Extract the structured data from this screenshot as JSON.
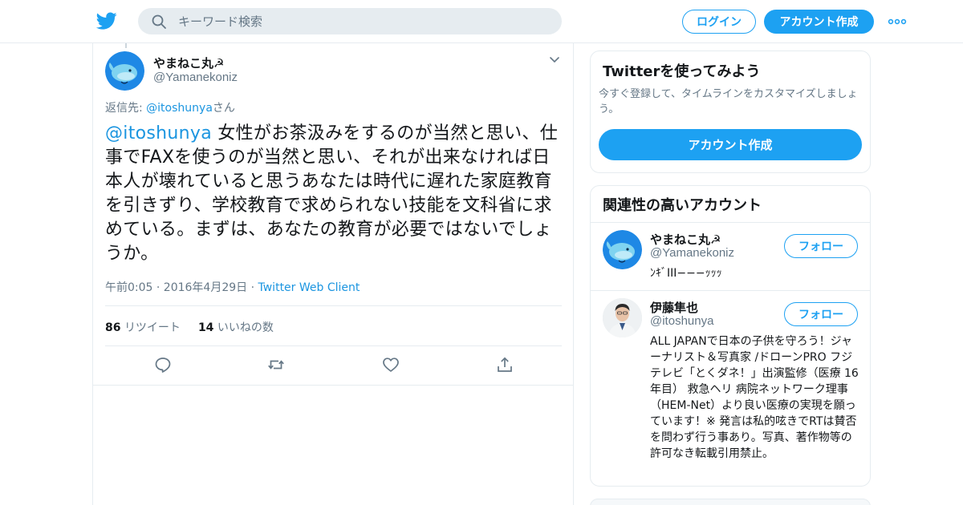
{
  "header": {
    "search_placeholder": "キーワード検索",
    "login_label": "ログイン",
    "signup_label": "アカウント作成"
  },
  "tweet": {
    "author_name": "やまねこ丸☭",
    "author_handle": "@Yamanekoniz",
    "reply_prefix": "返信先: ",
    "reply_mention": "@itoshunya",
    "reply_suffix": "さん",
    "mention": "@itoshunya",
    "body": " 女性がお茶汲みをするのが当然と思い、仕事でFAXを使うのが当然と思い、それが出来なければ日本人が壊れていると思うあなたは時代に遅れた家庭教育を引きずり、学校教育で求められない技能を文科省に求めている。まずは、あなたの教育が必要ではないでしょうか。",
    "timestamp": "午前0:05 · 2016年4月29日",
    "meta_sep": " · ",
    "client": "Twitter Web Client",
    "retweet_count": "86",
    "retweet_label": "リツイート",
    "like_count": "14",
    "like_label": "いいねの数"
  },
  "signup_card": {
    "title": "Twitterを使ってみよう",
    "subtitle": "今すぐ登録して、タイムラインをカスタマイズしましょう。",
    "button_label": "アカウント作成"
  },
  "related": {
    "title": "関連性の高いアカウント",
    "accounts": [
      {
        "name": "やまねこ丸☭",
        "handle": "@Yamanekoniz",
        "bio": "ﾝｷﾞIII−−−ｯｯｯ",
        "follow_label": "フォロー"
      },
      {
        "name": "伊藤隼也",
        "handle": "@itoshunya",
        "bio": "ALL JAPANで日本の子供を守ろう！ジャーナリスト＆写真家 /ドローンPRO フジテレビ「とくダネ！」出演監修（医療 16年目） 救急ヘリ 病院ネットワーク理事（HEM-Net）より良い医療の実現を願っています！※ 発言は私的呟きでRTは賛否を問わず行う事あり。写真、著作物等の許可なき転載引用禁止。",
        "follow_label": "フォロー"
      }
    ]
  },
  "colors": {
    "brand": "#1da1f2",
    "link": "#1b95e0",
    "muted": "#657786",
    "border": "#e6ecf0"
  },
  "icons": [
    "twitter-bird-icon",
    "search-icon",
    "more-dots-icon",
    "chevron-down-icon",
    "reply-icon",
    "retweet-icon",
    "like-icon",
    "share-icon"
  ]
}
